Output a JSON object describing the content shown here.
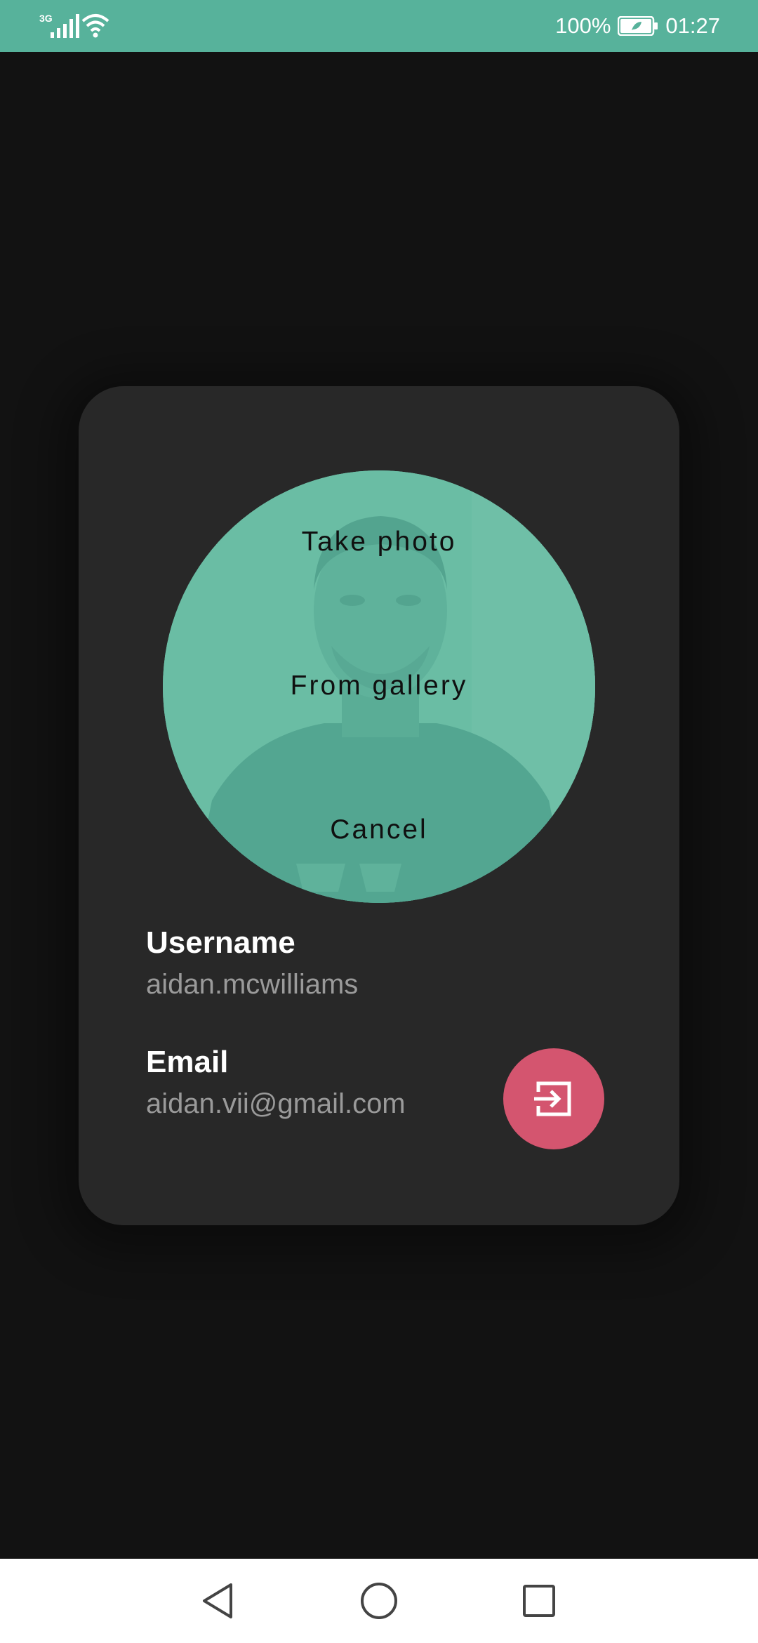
{
  "status_bar": {
    "network_type": "3G",
    "battery_percent": "100%",
    "time": "01:27",
    "icons": [
      "signal-icon",
      "wifi-icon",
      "battery-icon"
    ]
  },
  "profile": {
    "avatar_menu": {
      "take_photo": "Take photo",
      "from_gallery": "From gallery",
      "cancel": "Cancel"
    },
    "username_label": "Username",
    "username_value": "aidan.mcwilliams",
    "email_label": "Email",
    "email_value": "aidan.vii@gmail.com",
    "logout_icon": "logout-icon"
  },
  "nav_bar": {
    "icons": [
      "back-icon",
      "home-icon",
      "recents-icon"
    ]
  },
  "colors": {
    "status_bar": "#57b29b",
    "background": "#121212",
    "card": "#282828",
    "avatar_overlay": "#64b9a0",
    "fab": "#d4556f",
    "value_text": "#9a9a9a"
  }
}
